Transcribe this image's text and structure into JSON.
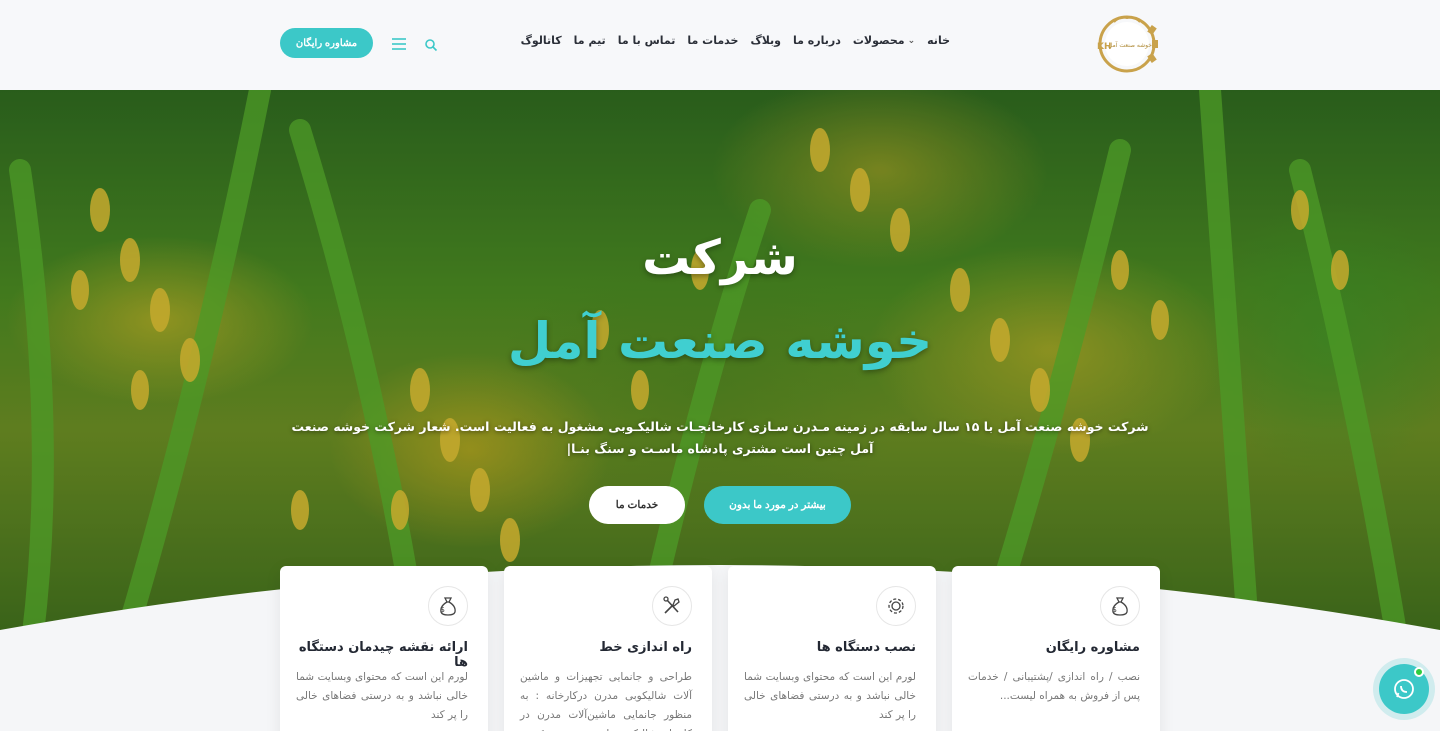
{
  "header": {
    "logo_text": "خوشه صنعت آمل",
    "logo_mark": "KH",
    "nav": [
      {
        "label": "خانه",
        "has_dropdown": false
      },
      {
        "label": "محصولات",
        "has_dropdown": true
      },
      {
        "label": "درباره ما",
        "has_dropdown": false
      },
      {
        "label": "وبلاگ",
        "has_dropdown": false
      },
      {
        "label": "خدمات ما",
        "has_dropdown": false
      },
      {
        "label": "تماس با ما",
        "has_dropdown": false
      },
      {
        "label": "تیم ما",
        "has_dropdown": false
      },
      {
        "label": "کاتالوگ",
        "has_dropdown": false
      }
    ],
    "consult_button": "مشاوره رایگان"
  },
  "hero": {
    "title_line1": "شرکت",
    "title_line2": "خوشه صنعت آمل",
    "description": "شرکت خوشه صنعت آمل با ۱۵ سال سابقه در زمینه مـدرن سـازی کارخانجـات شالیکـوبی مشغول به فعالیت است. شعار شرکت خوشه صنعت آمل چنین است مشتری پادشاه ماسـت و سنگ بنـا|",
    "btn_about": "بیشتر در مورد ما بدون",
    "btn_services": "خدمات ما"
  },
  "cards": [
    {
      "title": "مشاوره رایگان",
      "icon": "money-bag-icon",
      "text": "نصب / راه اندازی /پشتیبانی / خدمات پس از فروش به همراه لیست..."
    },
    {
      "title": "نصب دستگاه ها",
      "icon": "gear-icon",
      "text": "لورم این است که محتوای وبسایت شما خالی نباشد و به درستی فضاهای خالی را پر کند"
    },
    {
      "title": "راه اندازی خط",
      "icon": "tools-icon",
      "text": "طراحی و جانمایی تجهیزات و ماشین آلات شالیکوبی مدرن درکارخانه : به منظور جانمایی ماشین‌آلات مدرن در کارخانه شالیکوبی باید به صورت دقیق و به طور کامل"
    },
    {
      "title": "ارائه نقشه چیدمان دستگاه ها",
      "icon": "money-bag-icon",
      "text": "لورم این است که محتوای وبسایت شما خالی نباشد و به درستی فضاهای خالی را پر کند"
    }
  ],
  "colors": {
    "accent": "#3cc8c8",
    "text_dark": "#232833",
    "online": "#2ecc40"
  },
  "chat": {
    "icon": "whatsapp-icon"
  }
}
